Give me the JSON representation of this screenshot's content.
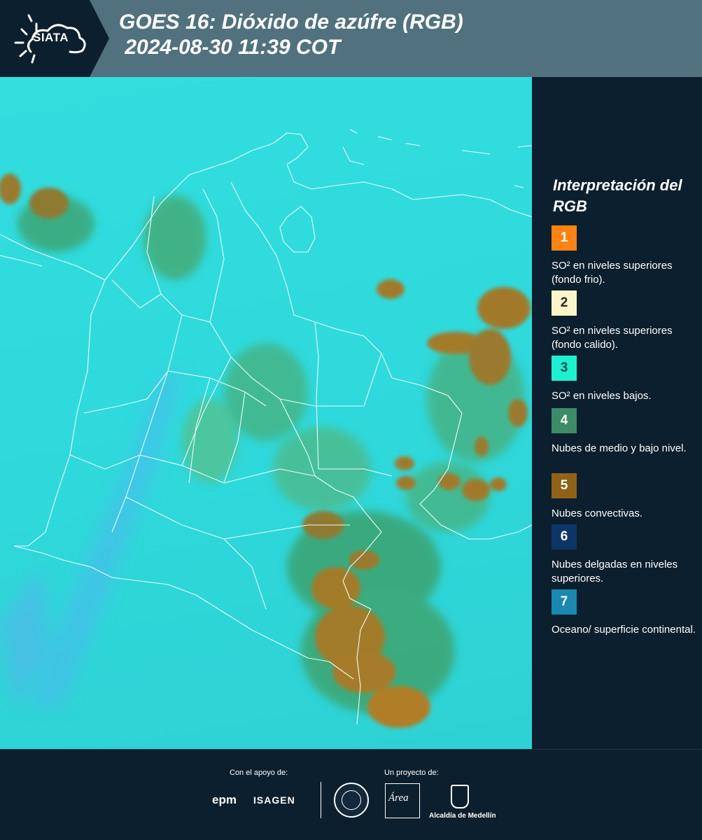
{
  "header": {
    "logo_text": "SIATA",
    "title": "GOES 16: Dióxido de azúfre (RGB)\n 2024-08-30 11:39 COT"
  },
  "map": {
    "background_color": "#32ddde",
    "cloud_colors": {
      "convective": "#9a7a2e",
      "mid_low": "#3ea66e"
    }
  },
  "legend": {
    "title": "Interpretación del RGB",
    "items": [
      {
        "number": "1",
        "color": "#ff8314",
        "label": "SO² en niveles superiores (fondo frio)."
      },
      {
        "number": "2",
        "color": "#fcf5c9",
        "label": "SO² en niveles superiores (fondo calido)."
      },
      {
        "number": "3",
        "color": "#1df0cf",
        "label": "SO² en niveles bajos."
      },
      {
        "number": "4",
        "color": "#3c8c68",
        "label": "Nubes de medio y bajo nivel."
      },
      {
        "number": "5",
        "color": "#906218",
        "label": "Nubes convectivas."
      },
      {
        "number": "6",
        "color": "#0d3567",
        "label": "Nubes delgadas en niveles superiores."
      },
      {
        "number": "7",
        "color": "#1a88b1",
        "label": "Oceano/ superficie continental."
      }
    ]
  },
  "footer": {
    "support_label": "Con el apoyo de:",
    "project_label": "Un proyecto de:",
    "sponsors": [
      "epm",
      "ISAGEN"
    ],
    "area_logo_text": "Área",
    "alcaldia_label": "Alcaldía de Medellín"
  }
}
